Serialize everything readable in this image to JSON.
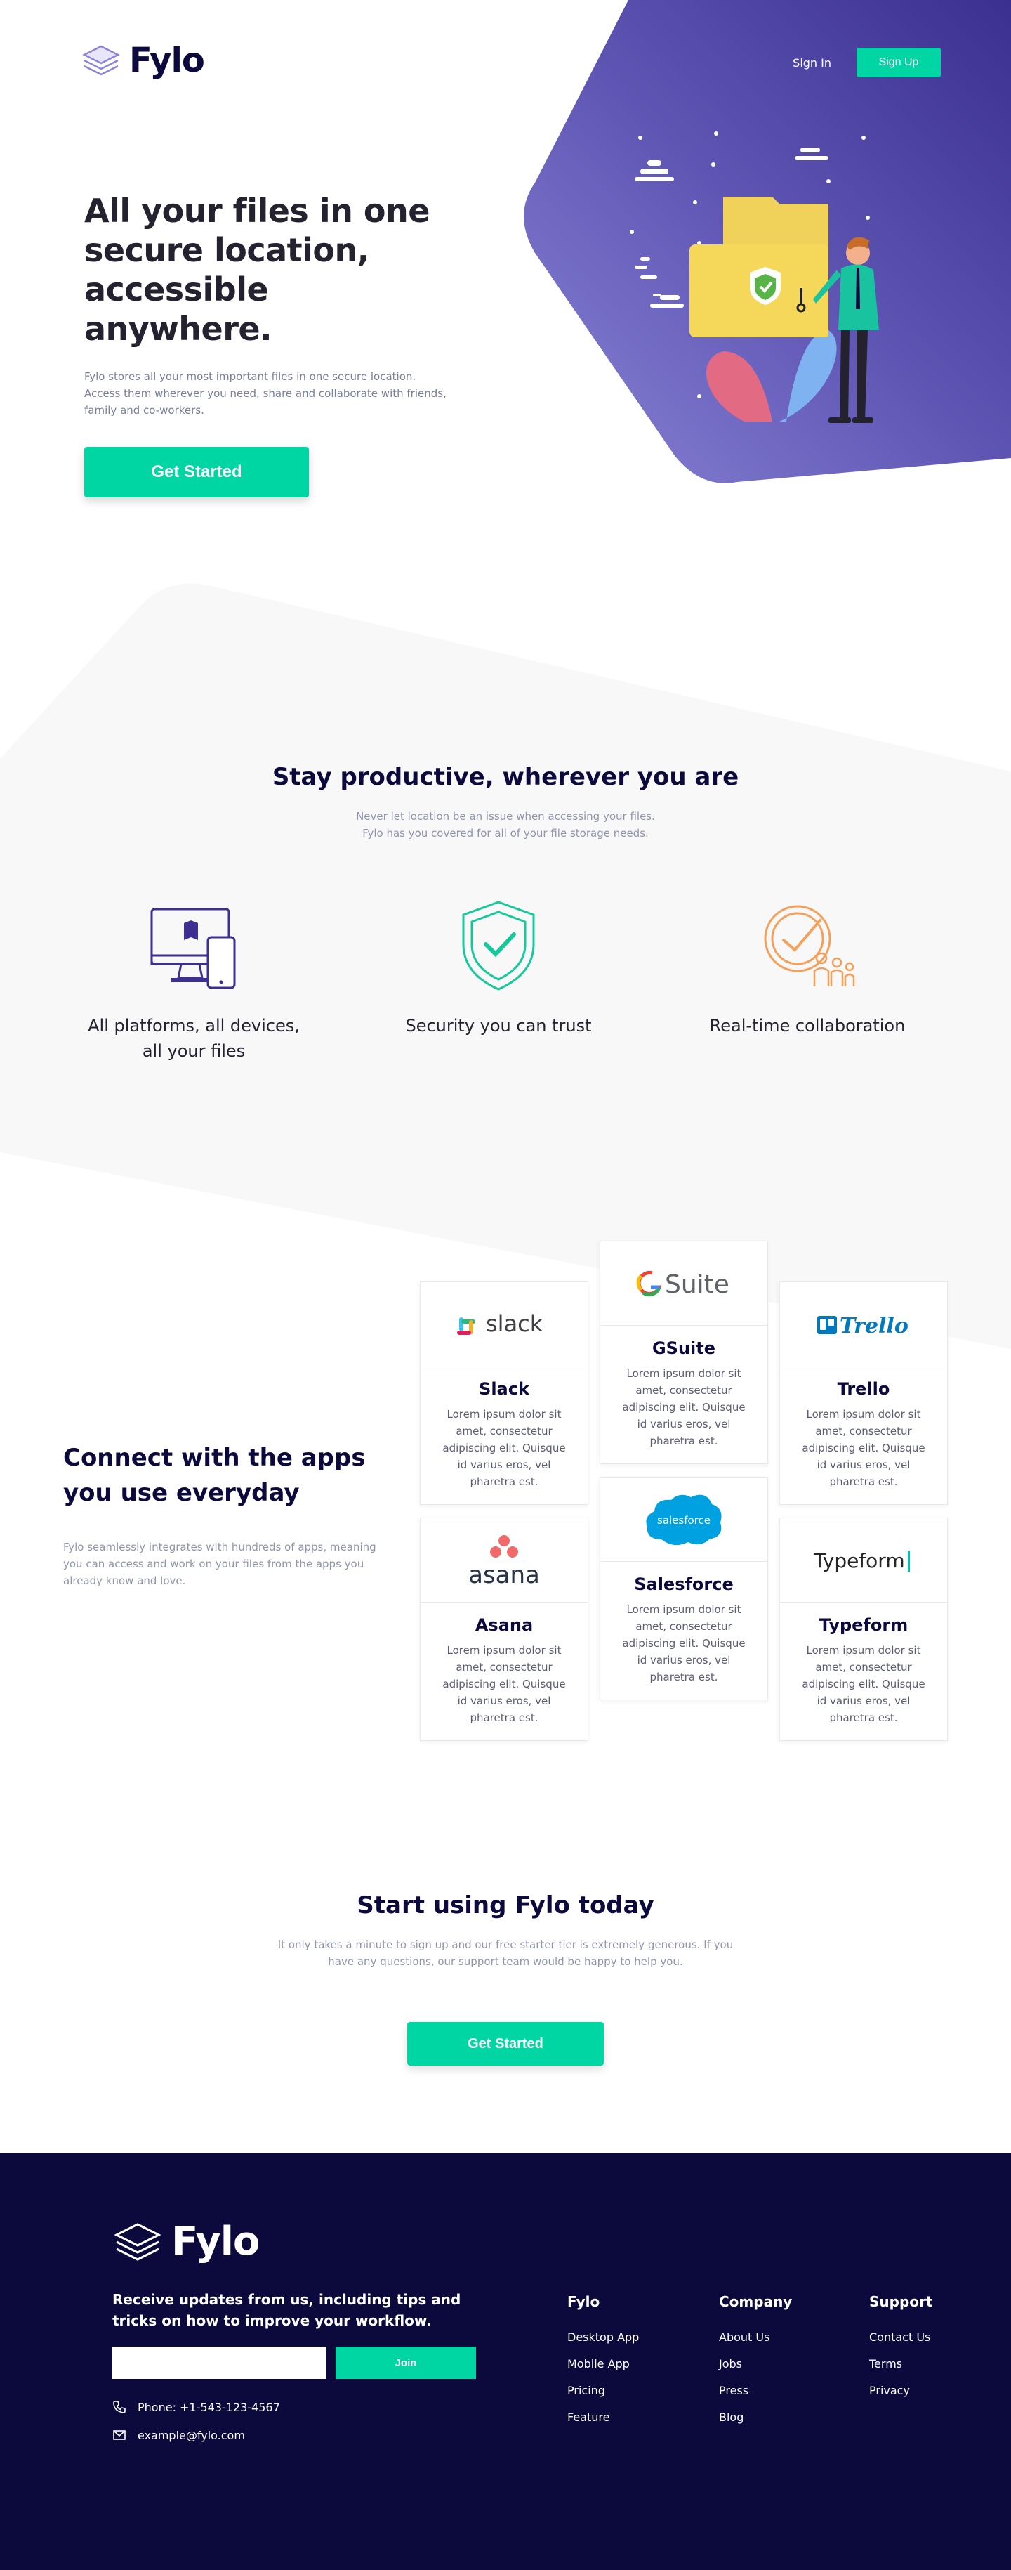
{
  "brand": {
    "name": "Fylo"
  },
  "nav": {
    "signin": "Sign In",
    "signup": "Sign Up"
  },
  "hero": {
    "title": "All your files in one secure location, accessible anywhere.",
    "text": "Fylo stores all your most important files in one secure location. Access them wherever you need, share and collaborate with friends, family and co-workers.",
    "cta": "Get Started"
  },
  "productive": {
    "title": "Stay productive, wherever you are",
    "text": "Never let location be an issue when accessing your files. Fylo has you covered for all of your file storage needs.",
    "features": [
      {
        "label": "All platforms, all devices, all your files",
        "icon": "devices-icon"
      },
      {
        "label": "Security you can trust",
        "icon": "shield-check-icon"
      },
      {
        "label": "Real-time collaboration",
        "icon": "collaboration-icon"
      }
    ]
  },
  "connect": {
    "title": "Connect with the apps you use everyday",
    "text": "Fylo seamlessly integrates with hundreds of apps, meaning you can access and work on your files from the apps you already know and love.",
    "apps": [
      {
        "name": "Slack",
        "logo": "slack",
        "text": "Lorem ipsum dolor sit amet, consectetur adipiscing elit. Quisque id varius eros, vel pharetra est."
      },
      {
        "name": "GSuite",
        "logo": "Suite",
        "text": "Lorem ipsum dolor sit amet, consectetur adipiscing elit. Quisque id varius eros, vel pharetra est."
      },
      {
        "name": "Trello",
        "logo": "Trello",
        "text": "Lorem ipsum dolor sit amet, consectetur adipiscing elit. Quisque id varius eros, vel pharetra est."
      },
      {
        "name": "Asana",
        "logo": "asana",
        "text": "Lorem ipsum dolor sit amet, consectetur adipiscing elit. Quisque id varius eros, vel pharetra est."
      },
      {
        "name": "Salesforce",
        "logo": "salesforce",
        "text": "Lorem ipsum dolor sit amet, consectetur adipiscing elit. Quisque id varius eros, vel pharetra est."
      },
      {
        "name": "Typeform",
        "logo": "Typeform",
        "text": "Lorem ipsum dolor sit amet, consectetur adipiscing elit. Quisque id varius eros, vel pharetra est."
      }
    ]
  },
  "start": {
    "title": "Start using Fylo today",
    "text": "It only takes a minute to sign up and our free starter tier is extremely generous. If you have any questions, our support team would be happy to help you.",
    "cta": "Get Started"
  },
  "footer": {
    "newsletter": "Receive updates from us, including tips and tricks on how to improve your workflow.",
    "email_placeholder": "",
    "join": "Join",
    "phone": "Phone: +1-543-123-4567",
    "email": "example@fylo.com",
    "columns": [
      {
        "title": "Fylo",
        "items": [
          "Desktop App",
          "Mobile App",
          "Pricing",
          "Feature"
        ]
      },
      {
        "title": "Company",
        "items": [
          "About Us",
          "Jobs",
          "Press",
          "Blog"
        ]
      },
      {
        "title": "Support",
        "items": [
          "Contact Us",
          "Terms",
          "Privacy"
        ]
      }
    ]
  },
  "colors": {
    "accent": "#00d6a4",
    "navy": "#0c0a3d",
    "purple": "#5f55b3"
  }
}
